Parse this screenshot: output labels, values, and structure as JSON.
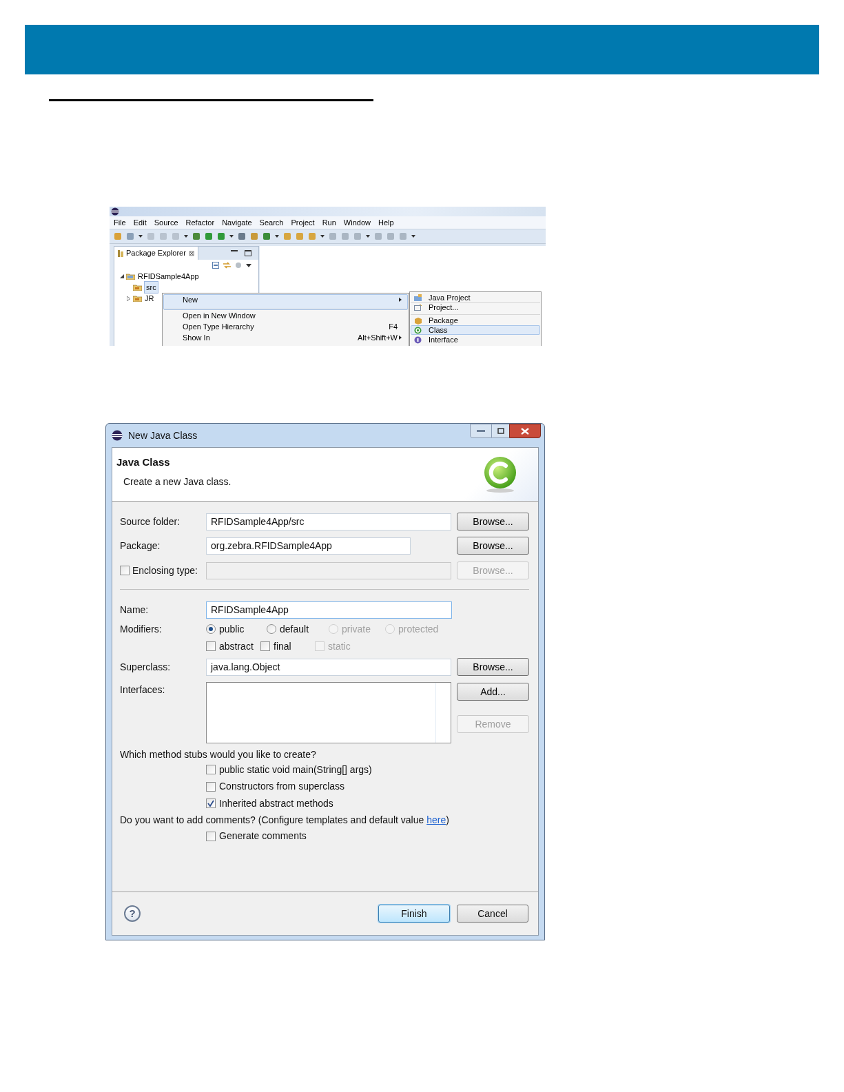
{
  "eclipse_window": {
    "menu": [
      "File",
      "Edit",
      "Source",
      "Refactor",
      "Navigate",
      "Search",
      "Project",
      "Run",
      "Window",
      "Help"
    ],
    "view_tab": {
      "label": "Package Explorer",
      "close": "⊠"
    },
    "tree": [
      {
        "label": "RFIDSample4App",
        "expanded": true,
        "selected": false,
        "children": [
          {
            "label": "src",
            "selected": true
          },
          {
            "label": "JR",
            "expanded": false,
            "selected": false
          }
        ]
      }
    ],
    "context_menu": [
      {
        "label": "New",
        "submenu": true,
        "selected": true,
        "separator_after": true
      },
      {
        "label": "Open in New Window",
        "submenu": false,
        "selected": false,
        "separator_after": false
      },
      {
        "label": "Open Type Hierarchy",
        "shortcut": "F4",
        "submenu": false,
        "selected": false,
        "separator_after": false
      },
      {
        "label": "Show In",
        "shortcut": "Alt+Shift+W",
        "submenu": true,
        "selected": false,
        "separator_after": false
      }
    ],
    "submenu": [
      {
        "label": "Java Project",
        "selected": false,
        "separator_after": false
      },
      {
        "label": "Project...",
        "selected": false,
        "separator_after": true
      },
      {
        "label": "Package",
        "selected": false,
        "separator_after": false
      },
      {
        "label": "Class",
        "selected": true,
        "separator_after": false
      },
      {
        "label": "Interface",
        "selected": false,
        "separator_after": false
      }
    ]
  },
  "dialog": {
    "title": "New Java Class",
    "heading": "Java Class",
    "description": "Create a new Java class.",
    "source_folder": {
      "label": "Source folder:",
      "value": "RFIDSample4App/src",
      "button": {
        "label": "Browse...",
        "disabled": false
      }
    },
    "package": {
      "label": "Package:",
      "value": "org.zebra.RFIDSample4App",
      "button": {
        "label": "Browse...",
        "disabled": false
      }
    },
    "enclosing_type": {
      "label": "Enclosing type:",
      "checked": false,
      "button": {
        "label": "Browse...",
        "disabled": true
      }
    },
    "name": {
      "label": "Name:",
      "value": "RFIDSample4App"
    },
    "modifiers": {
      "label": "Modifiers:",
      "access": [
        {
          "label": "public",
          "selected": true,
          "disabled": false
        },
        {
          "label": "default",
          "selected": false,
          "disabled": false
        },
        {
          "label": "private",
          "selected": false,
          "disabled": true
        },
        {
          "label": "protected",
          "selected": false,
          "disabled": true
        }
      ],
      "flags": [
        {
          "label": "abstract",
          "checked": false,
          "disabled": false
        },
        {
          "label": "final",
          "checked": false,
          "disabled": false
        },
        {
          "label": "static",
          "checked": false,
          "disabled": true
        }
      ]
    },
    "superclass": {
      "label": "Superclass:",
      "value": "java.lang.Object",
      "button": {
        "label": "Browse...",
        "disabled": false
      }
    },
    "interfaces": {
      "label": "Interfaces:",
      "buttons": [
        {
          "label": "Add...",
          "disabled": false
        },
        {
          "label": "Remove",
          "disabled": true
        }
      ]
    },
    "stubs": {
      "question": "Which method stubs would you like to create?",
      "options": [
        {
          "label": "public static void main(String[] args)",
          "checked": false
        },
        {
          "label": "Constructors from superclass",
          "checked": false
        },
        {
          "label": "Inherited abstract methods",
          "checked": true
        }
      ]
    },
    "comments": {
      "question": "Do you want to add comments? (Configure templates and default value ",
      "link": "here",
      "after": ")",
      "options": [
        {
          "label": "Generate comments",
          "checked": false
        }
      ]
    },
    "help": "?",
    "buttons": [
      {
        "label": "Finish",
        "default": true
      },
      {
        "label": "Cancel",
        "default": false
      }
    ]
  }
}
